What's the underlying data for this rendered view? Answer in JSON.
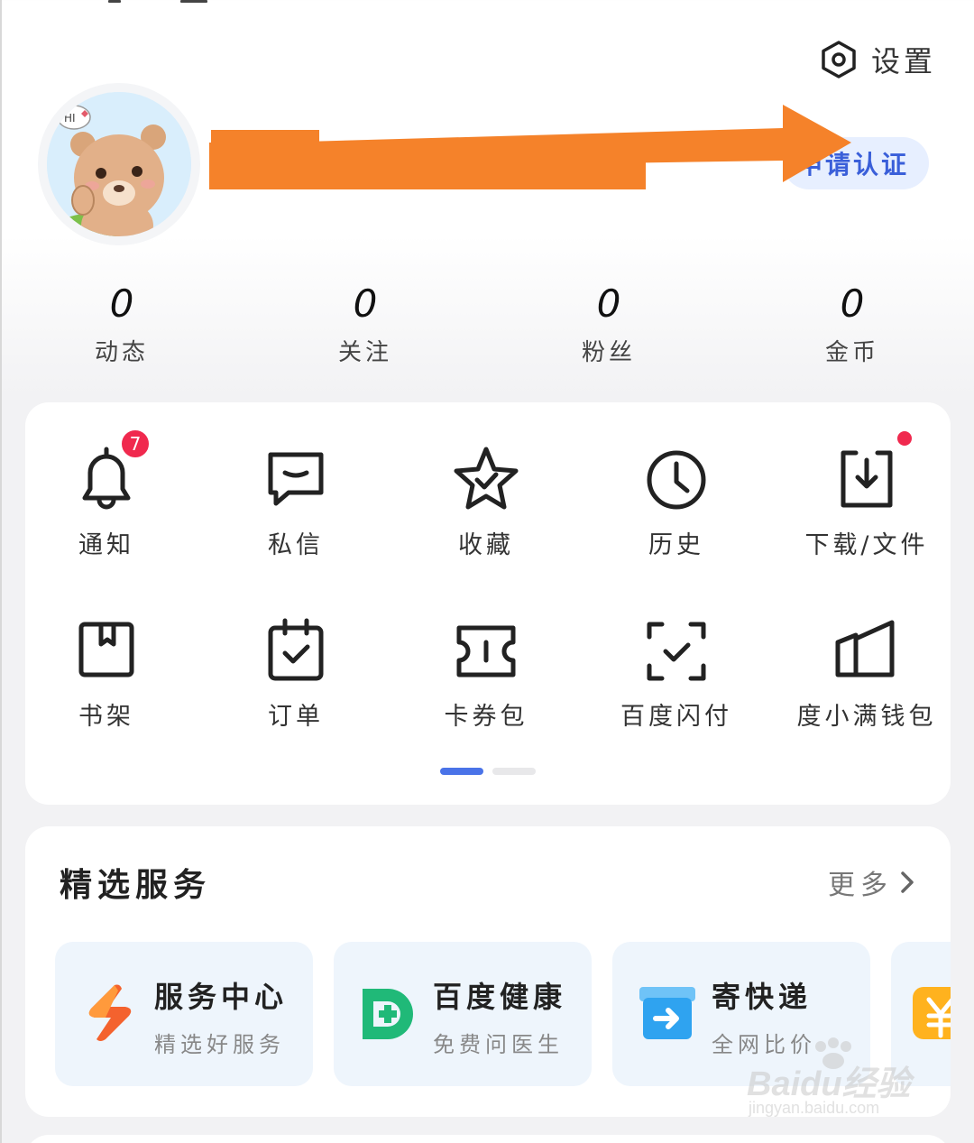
{
  "settings": {
    "label": "设置",
    "icon": "gear-hexagon-icon"
  },
  "profile": {
    "verify_label": "申请认证"
  },
  "stats": [
    {
      "value": "0",
      "label": "动态"
    },
    {
      "value": "0",
      "label": "关注"
    },
    {
      "value": "0",
      "label": "粉丝"
    },
    {
      "value": "0",
      "label": "金币"
    }
  ],
  "grid": {
    "items": [
      {
        "label": "通知",
        "icon": "bell-icon"
      },
      {
        "label": "私信",
        "icon": "message-icon"
      },
      {
        "label": "收藏",
        "icon": "star-icon"
      },
      {
        "label": "历史",
        "icon": "clock-icon"
      },
      {
        "label": "下载/文件",
        "icon": "download-icon"
      },
      {
        "label": "书架",
        "icon": "bookshelf-icon"
      },
      {
        "label": "订单",
        "icon": "calendar-check-icon"
      },
      {
        "label": "卡券包",
        "icon": "ticket-icon"
      },
      {
        "label": "百度闪付",
        "icon": "scan-pay-icon"
      },
      {
        "label": "度小满钱包",
        "icon": "wallet-icon"
      }
    ],
    "notification_badge": "7",
    "page_index": 1,
    "page_count": 2
  },
  "services": {
    "title": "精选服务",
    "more_label": "更多",
    "items": [
      {
        "name": "服务中心",
        "sub": "精选好服务",
        "icon": "service-center-icon"
      },
      {
        "name": "百度健康",
        "sub": "免费问医生",
        "icon": "health-icon"
      },
      {
        "name": "寄快递",
        "sub": "全网比价",
        "icon": "express-icon"
      }
    ]
  },
  "watermark": {
    "brand": "Baidu经验",
    "url": "jingyan.baidu.com"
  },
  "colors": {
    "accent": "#4a73e8",
    "badge": "#f0294e",
    "annotation_arrow": "#f5822a"
  }
}
